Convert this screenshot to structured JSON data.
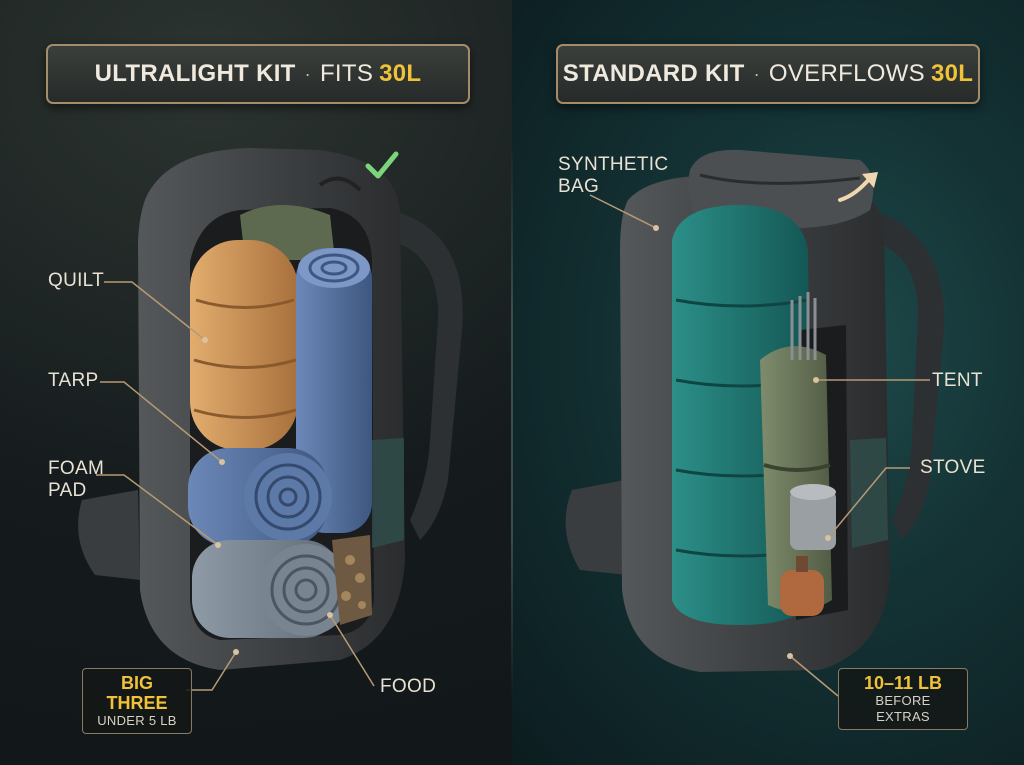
{
  "left_title": {
    "main": "ULTRALIGHT KIT",
    "sep": "·",
    "rest": "FITS",
    "accent": "30L"
  },
  "right_title": {
    "main": "STANDARD KIT",
    "sep": "·",
    "rest": "OVERFLOWS",
    "accent": "30L"
  },
  "left_labels": {
    "quilt": "QUILT",
    "tarp": "TARP",
    "foam_pad_1": "FOAM",
    "foam_pad_2": "PAD",
    "food": "FOOD"
  },
  "left_callout": {
    "big": "BIG THREE",
    "small": "UNDER 5 LB"
  },
  "right_labels": {
    "synthetic_1": "SYNTHETIC",
    "synthetic_2": "BAG",
    "tent": "TENT",
    "stove": "STOVE"
  },
  "right_callout": {
    "big": "10–11 LB",
    "small": "BEFORE EXTRAS"
  },
  "icons": {
    "check": "check-icon",
    "overflow": "arrow-up-right-icon"
  },
  "colors": {
    "accent": "#f0c23a",
    "border": "#a48b6a",
    "check": "#7bd67b",
    "quilt": "#c98f52",
    "pad": "#5470a0",
    "synthetic_bag": "#1f7a76",
    "tent": "#6b7a5c",
    "pack": "#3c3f41"
  }
}
